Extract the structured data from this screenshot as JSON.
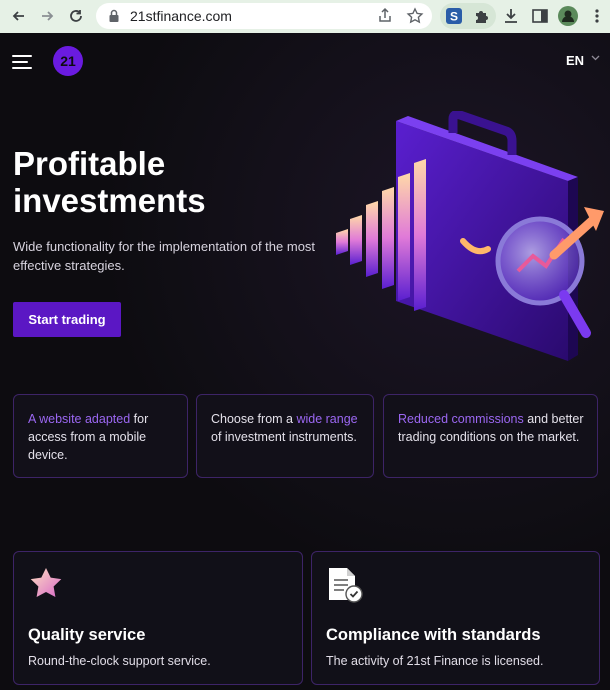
{
  "browser": {
    "url": "21stfinance.com",
    "back_icon": "arrow-left-icon",
    "forward_icon": "arrow-right-icon",
    "reload_icon": "reload-icon",
    "share_icon": "share-icon",
    "star_icon": "star-icon",
    "extension_s_icon": "extension-s-icon",
    "puzzle_icon": "puzzle-icon",
    "download_icon": "download-icon",
    "sidepanel_icon": "sidepanel-icon",
    "profile_icon": "profile-icon",
    "more_icon": "more-vertical-icon"
  },
  "header": {
    "logo_text": "21",
    "language": "EN",
    "menu_icon": "hamburger-menu-icon"
  },
  "hero": {
    "title_line1": "Profitable",
    "title_line2": "investments",
    "subtitle": "Wide functionality for the implementation of the most effective strategies.",
    "cta_label": "Start trading"
  },
  "features": [
    {
      "accent": "A website adapted",
      "text_after": " for access from a mobile device."
    },
    {
      "text_before": "Choose from a ",
      "accent": "wide range",
      "text_after": " of investment instruments."
    },
    {
      "accent": "Reduced commissions",
      "text_after": " and better trading conditions on the market."
    }
  ],
  "services": [
    {
      "icon": "star-icon",
      "title": "Quality service",
      "description": "Round-the-clock support service."
    },
    {
      "icon": "document-check-icon",
      "title": "Compliance with standards",
      "description": "The activity of 21st Finance is licensed."
    }
  ],
  "colors": {
    "page_bg": "#0d0c10",
    "accent_purple": "#5b17c4",
    "accent_text": "#9b67f2",
    "card_border": "#3d2467",
    "chrome_bg": "#e6f1e6"
  }
}
